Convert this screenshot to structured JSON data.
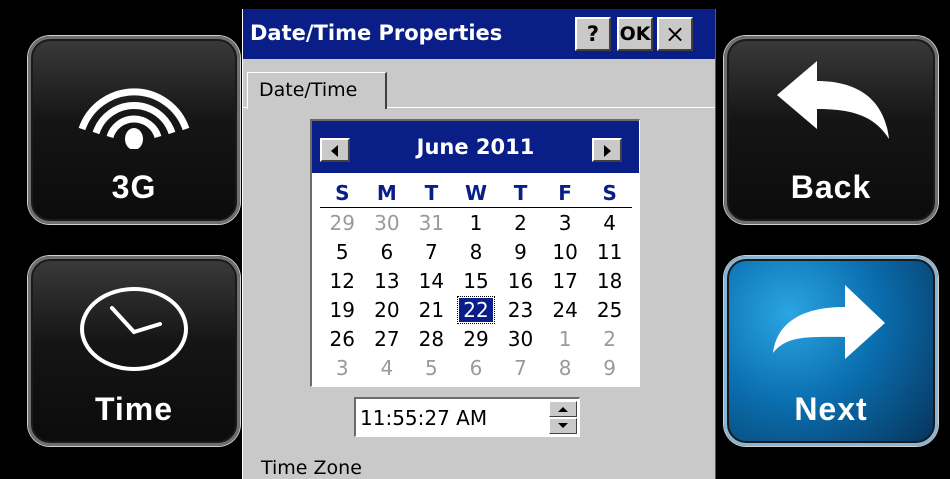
{
  "tiles": {
    "g3": {
      "label": "3G"
    },
    "time": {
      "label": "Time"
    },
    "back": {
      "label": "Back"
    },
    "next": {
      "label": "Next"
    }
  },
  "dialog": {
    "title": "Date/Time Properties",
    "help_label": "?",
    "ok_label": "OK",
    "close_label": "×",
    "tab_label": "Date/Time",
    "calendar": {
      "month_label": "June 2011",
      "weekdays": [
        "S",
        "M",
        "T",
        "W",
        "T",
        "F",
        "S"
      ],
      "weeks": [
        [
          "29",
          "30",
          "31",
          "1",
          "2",
          "3",
          "4"
        ],
        [
          "5",
          "6",
          "7",
          "8",
          "9",
          "10",
          "11"
        ],
        [
          "12",
          "13",
          "14",
          "15",
          "16",
          "17",
          "18"
        ],
        [
          "19",
          "20",
          "21",
          "22",
          "23",
          "24",
          "25"
        ],
        [
          "26",
          "27",
          "28",
          "29",
          "30",
          "1",
          "2"
        ],
        [
          "3",
          "4",
          "5",
          "6",
          "7",
          "8",
          "9"
        ]
      ],
      "other_month": [
        [
          true,
          true,
          true,
          false,
          false,
          false,
          false
        ],
        [
          false,
          false,
          false,
          false,
          false,
          false,
          false
        ],
        [
          false,
          false,
          false,
          false,
          false,
          false,
          false
        ],
        [
          false,
          false,
          false,
          false,
          false,
          false,
          false
        ],
        [
          false,
          false,
          false,
          false,
          false,
          true,
          true
        ],
        [
          true,
          true,
          true,
          true,
          true,
          true,
          true
        ]
      ],
      "selected_day": "22"
    },
    "time_value": "11:55:27 AM",
    "timezone_label": "Time Zone"
  },
  "colors": {
    "titlebar": "#0a1e88",
    "dialog_bg": "#c9c9c9",
    "next_tile": "#0b6fb0"
  },
  "icons": {
    "g3": "signal-waves-icon",
    "time": "clock-icon",
    "back": "back-arrow-icon",
    "next": "next-arrow-icon",
    "prev_month": "triangle-left-icon",
    "next_month": "triangle-right-icon"
  }
}
